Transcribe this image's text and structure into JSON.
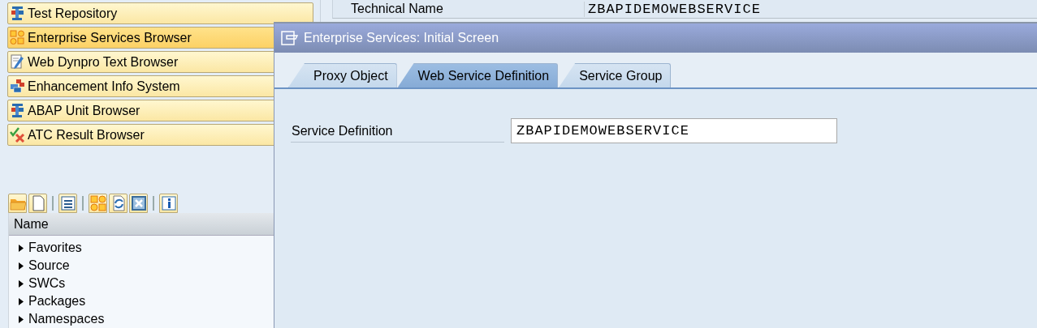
{
  "nav_buttons": [
    {
      "label": "Test Repository",
      "selected": false
    },
    {
      "label": "Enterprise Services Browser",
      "selected": true
    },
    {
      "label": "Web Dynpro Text Browser",
      "selected": false
    },
    {
      "label": "Enhancement Info System",
      "selected": false
    },
    {
      "label": "ABAP Unit Browser",
      "selected": false
    },
    {
      "label": "ATC Result Browser",
      "selected": false
    }
  ],
  "tree": {
    "header": "Name",
    "items": [
      {
        "label": "Favorites",
        "expanded": false
      },
      {
        "label": "Source",
        "expanded": false
      },
      {
        "label": "SWCs",
        "expanded": false
      },
      {
        "label": "Packages",
        "expanded": false
      },
      {
        "label": "Namespaces",
        "expanded": false
      }
    ]
  },
  "background_form": {
    "label": "Technical Name",
    "value": "ZBAPIDEMOWEBSERVICE"
  },
  "dialog": {
    "title": "Enterprise Services: Initial Screen",
    "tabs": [
      {
        "label": "Proxy Object",
        "selected": false
      },
      {
        "label": "Web Service Definition",
        "selected": true
      },
      {
        "label": "Service Group",
        "selected": false
      }
    ],
    "fields": [
      {
        "label": "Service Definition",
        "value": "ZBAPIDEMOWEBSERVICE"
      }
    ]
  }
}
